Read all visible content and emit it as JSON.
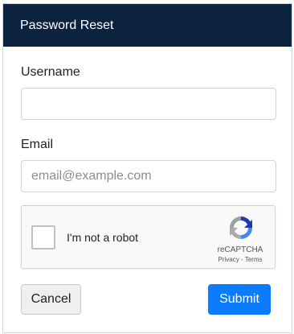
{
  "dialog": {
    "title": "Password Reset"
  },
  "form": {
    "username_label": "Username",
    "username_value": "",
    "username_placeholder": "",
    "email_label": "Email",
    "email_value": "",
    "email_placeholder": "email@example.com"
  },
  "captcha": {
    "label": "I'm not a robot",
    "brand": "reCAPTCHA",
    "links": "Privacy - Terms",
    "icon": "recaptcha-logo-icon",
    "checked": false
  },
  "actions": {
    "cancel_label": "Cancel",
    "submit_label": "Submit"
  },
  "colors": {
    "header_bg": "#0c2340",
    "submit_bg": "#0b7dfc",
    "cancel_bg": "#efefef"
  }
}
